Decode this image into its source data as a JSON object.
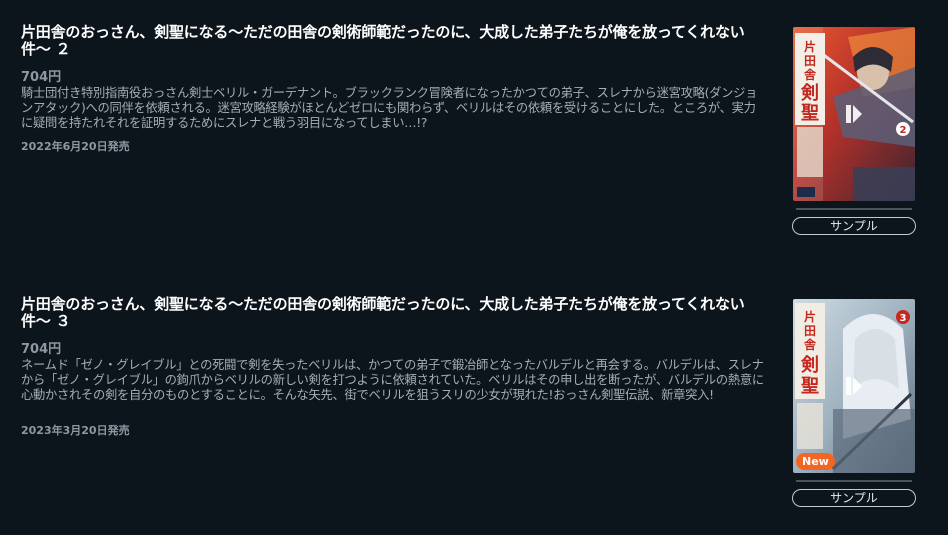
{
  "items": [
    {
      "title": "片田舎のおっさん、剣聖になる～ただの田舎の剣術師範だったのに、大成した弟子たちが俺を放ってくれない件～ ２",
      "price": "704円",
      "description": "騎士団付き特別指南役おっさん剣士ベリル・ガーデナント。ブラックランク冒険者になったかつての弟子、スレナから迷宮攻略(ダンジョンアタック)への同伴を依頼される。迷宮攻略経験がほとんどゼロにも関わらず、ベリルはその依頼を受けることにした。ところが、実力に疑問を持たれそれを証明するためにスレナと戦う羽目になってしまい…!?",
      "release_date": "2022年6月20日発売",
      "sample_label": "サンプル",
      "cover": {
        "volume": "2",
        "title_glyphs": "片田舎のおっさん 剣聖になる",
        "palette": [
          "#c8402e",
          "#e8d6c2",
          "#3b3f52"
        ]
      }
    },
    {
      "title": "片田舎のおっさん、剣聖になる～ただの田舎の剣術師範だったのに、大成した弟子たちが俺を放ってくれない件～ ３",
      "price": "704円",
      "description": "ネームド「ゼノ・グレイブル」との死闘で剣を失ったベリルは、かつての弟子で鍛冶師となったバルデルと再会する。バルデルは、スレナから「ゼノ・グレイブル」の鉤爪からベリルの新しい剣を打つように依頼されていた。ベリルはその申し出を断ったが、バルデルの熱意に心動かされその剣を自分のものとすることに。そんな矢先、街でベリルを狙うスリの少女が現れた!おっさん剣聖伝説、新章突入!",
      "release_date": "2023年3月20日発売",
      "sample_label": "サンプル",
      "badge": "New",
      "cover": {
        "volume": "3",
        "title_glyphs": "片田舎のおっさん 剣聖になる",
        "palette": [
          "#b8c9d6",
          "#d24a3a",
          "#6f7c8c"
        ]
      }
    }
  ],
  "icons": {
    "play": "play-pause-icon"
  },
  "colors": {
    "background": "#0c141c",
    "title": "#ffffff",
    "body_text": "#a5aeb7",
    "badge": "#f26522"
  }
}
